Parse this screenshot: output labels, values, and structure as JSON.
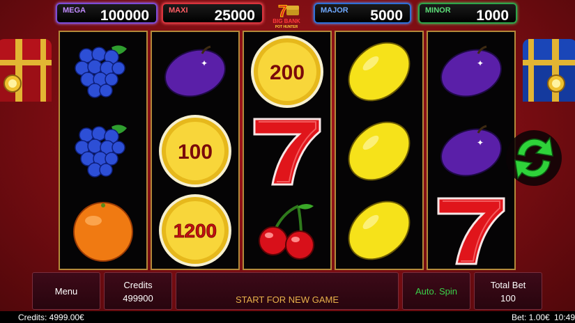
{
  "jackpots": {
    "mega": {
      "label": "MEGA",
      "value": "100000"
    },
    "maxi": {
      "label": "MAXI",
      "value": "25000"
    },
    "major": {
      "label": "MAJOR",
      "value": "5000"
    },
    "minor": {
      "label": "MINOR",
      "value": "1000"
    }
  },
  "logo": {
    "line1": "BIG BANK",
    "line2": "POT HUNTER"
  },
  "reels": [
    [
      "grapes-icon",
      "grapes-icon",
      "orange-icon"
    ],
    [
      "plum-icon",
      "coin-icon",
      "coin-icon"
    ],
    [
      "coin-icon",
      "seven-icon",
      "cherry-icon"
    ],
    [
      "lemon-icon",
      "lemon-icon",
      "lemon-icon"
    ],
    [
      "plum-icon",
      "plum-icon",
      "seven-icon"
    ]
  ],
  "coins": {
    "r2s2": "100",
    "r2s3": "1200",
    "r3s1": "200"
  },
  "panel": {
    "menu": "Menu",
    "credits_label": "Credits",
    "credits_value": "499900",
    "start": "START FOR NEW GAME",
    "autospin": "Auto. Spin",
    "total_bet_label": "Total Bet",
    "total_bet_value": "100"
  },
  "status": {
    "credits": "Credits: 4999.00€",
    "bet": "Bet: 1.00€",
    "time": "10:49"
  },
  "colors": {
    "mega": "#7d4bd6",
    "maxi": "#d8333c",
    "major": "#2f6fd8",
    "minor": "#2ea54a",
    "reel_border": "#b38a3a",
    "spin_arrows": "#2fd23a"
  }
}
